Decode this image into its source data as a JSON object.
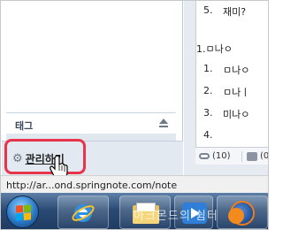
{
  "note": {
    "lines": [
      {
        "num": "5.",
        "text": "재미?"
      },
      {
        "num": "",
        "text": "1.ㅁ나ㅇ"
      },
      {
        "num": "1.",
        "text": "ㅁ나ㅇ"
      },
      {
        "num": "2.",
        "text": "ㅁ나ㅣ"
      },
      {
        "num": "3.",
        "text": "미나ㅇ"
      },
      {
        "num": "4.",
        "text": ""
      }
    ],
    "footer": {
      "link_count": "(10)",
      "comment_count": "(0)"
    }
  },
  "sidebar": {
    "tag_label": "태그",
    "manage_label": "관리하기"
  },
  "status": {
    "url": "http://ar...ond.springnote.com/note"
  },
  "taskbar": {
    "items": [
      "start",
      "internet-explorer",
      "windows-explorer",
      "media-player",
      "firefox"
    ]
  },
  "watermark": "아크몬드의 쉼터",
  "colors": {
    "highlight": "#e8344a",
    "taskbar": "#2a4a73"
  }
}
